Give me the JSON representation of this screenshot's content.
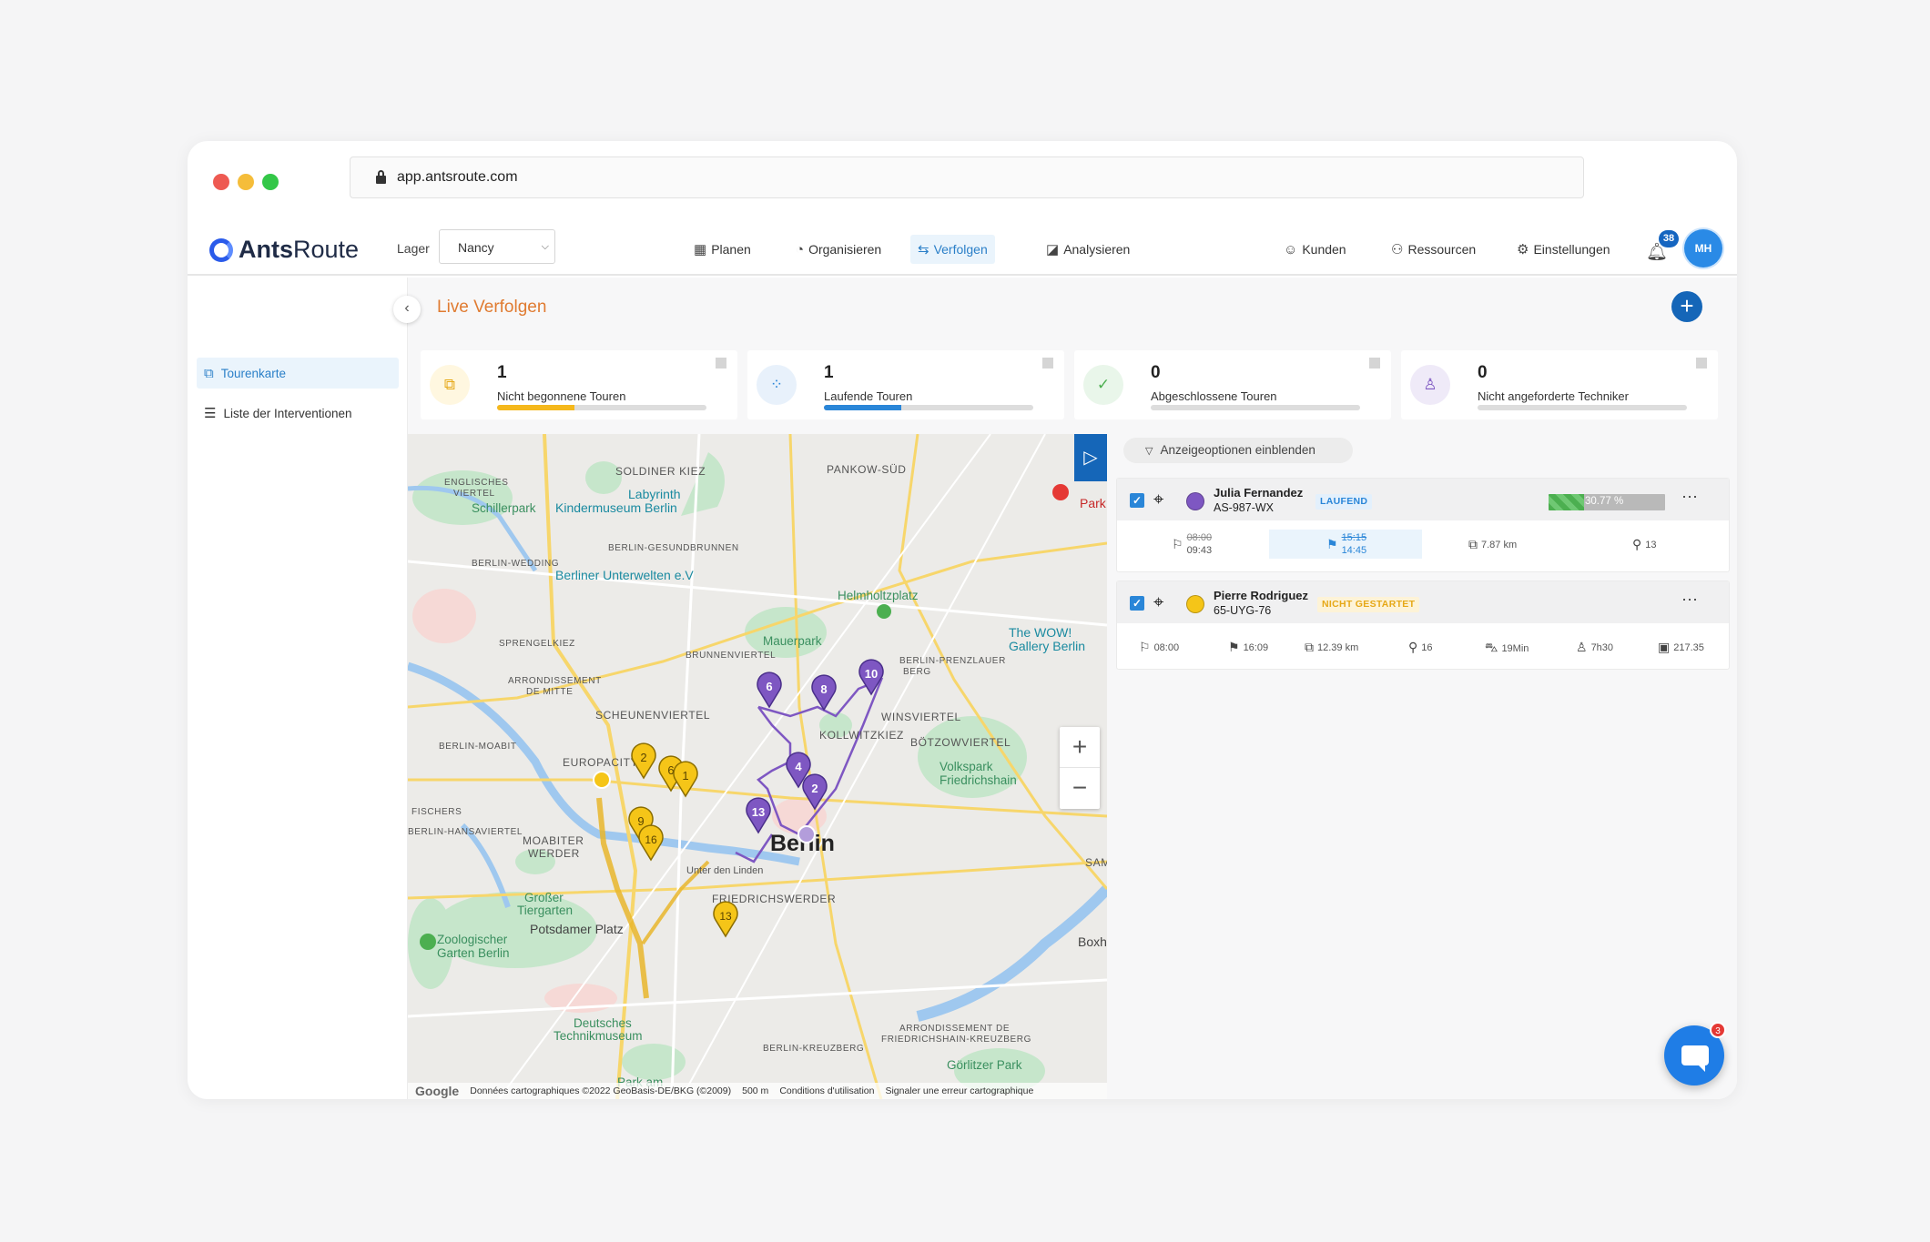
{
  "browser": {
    "url": "app.antsroute.com"
  },
  "app": {
    "logo": {
      "part1": "Ants",
      "part2": "Route"
    },
    "lager": {
      "label": "Lager",
      "value": "Nancy"
    },
    "nav": [
      {
        "label": "Planen",
        "icon": "calendar-icon"
      },
      {
        "label": "Organisieren",
        "icon": "gauge-icon"
      },
      {
        "label": "Verfolgen",
        "icon": "signpost-icon",
        "active": true
      },
      {
        "label": "Analysieren",
        "icon": "chart-icon"
      },
      {
        "label": "Kunden",
        "icon": "customers-icon"
      },
      {
        "label": "Ressourcen",
        "icon": "resources-icon"
      },
      {
        "label": "Einstellungen",
        "icon": "gear-icon"
      }
    ],
    "notifications": {
      "count": "38"
    },
    "user": {
      "initials": "MH"
    }
  },
  "sidebar": {
    "items": [
      {
        "label": "Tourenkarte",
        "icon": "map-icon",
        "active": true
      },
      {
        "label": "Liste der Interventionen",
        "icon": "list-icon"
      }
    ]
  },
  "page": {
    "title": "Live Verfolgen"
  },
  "stats": [
    {
      "value": "1",
      "label": "Nicht begonnene Touren",
      "fill": 0.37,
      "color": "#f5b81c",
      "iconbg": "#fff7e0",
      "iconcolor": "#e6a817"
    },
    {
      "value": "1",
      "label": "Laufende Touren",
      "fill": 0.37,
      "color": "#2a86d8",
      "iconbg": "#e8f1fb",
      "iconcolor": "#2a86d8"
    },
    {
      "value": "0",
      "label": "Abgeschlossene Touren",
      "fill": 0,
      "color": "#4caf50",
      "iconbg": "#e9f6ea",
      "iconcolor": "#4caf50"
    },
    {
      "value": "0",
      "label": "Nicht angeforderte Techniker",
      "fill": 0,
      "color": "#7e57c2",
      "iconbg": "#efeaf8",
      "iconcolor": "#7e57c2"
    }
  ],
  "map": {
    "labels": {
      "soldiner": "SOLDINER KIEZ",
      "pankow": "PANKOW-SÜD",
      "labyrinth": "Labyrinth",
      "kindermuseum": "Kindermuseum Berlin",
      "englisches": "ENGLISCHES",
      "viertel": "VIERTEL",
      "schillerpark": "Schillerpark",
      "gesundbrunnen": "BERLIN-GESUNDBRUNNEN",
      "wedding": "BERLIN-WEDDING",
      "unterwelten": "Berliner Unterwelten e.V",
      "helmholtz": "Helmholtzplatz",
      "mauerpark": "Mauerpark",
      "brunnen": "BRUNNENVIERTEL",
      "sprengel": "SPRENGELKIEZ",
      "wow": "The WOW!",
      "gallery": "Gallery Berlin",
      "prenzlauer": "BERLIN-PRENZLAUER",
      "berg": "BERG",
      "arrondissement": "ARRONDISSEMENT",
      "mitte": "DE MITTE",
      "scheunen": "SCHEUNENVIERTEL",
      "winsviertel": "WINSVIERTEL",
      "kollwitz": "KOLLWITZKIEZ",
      "boetzow": "BÖTZOWVIERTEL",
      "moabit": "BERLIN-MOABIT",
      "europacity": "EUROPACITY",
      "volkspark": "Volkspark",
      "friedrichshain": "Friedrichshain",
      "berlin": "Berlin",
      "fischer": "FISCHERS",
      "hansa": "BERLIN-HANSAVIERTEL",
      "moabiter": "MOABITER",
      "werder": "WERDER",
      "tiergarten1": "Großer",
      "tiergarten2": "Tiergarten",
      "potsdamer": "Potsdamer Platz",
      "zoo1": "Zoologischer",
      "zoo2": "Garten Berlin",
      "friedrichswerder": "FRIEDRICHSWERDER",
      "boxh": "Boxh",
      "technik1": "Deutsches",
      "technik2": "Technikmuseum",
      "kreuzberg": "BERLIN-KREUZBERG",
      "arrondissement2": "ARRONDISSEMENT DE",
      "fkreuzberg": "FRIEDRICHSHAIN-KREUZBERG",
      "goerlitzer": "Görlitzer Park",
      "parkam": "Park am",
      "park": "Park",
      "sam": "SAM",
      "unterlinden": "Unter den Linden"
    },
    "purple_stops": [
      "6",
      "8",
      "10",
      "4",
      "2",
      "13"
    ],
    "yellow_stops": [
      "2",
      "6",
      "1",
      "9",
      "16",
      "13"
    ],
    "zoom_in": "+",
    "zoom_out": "−",
    "footer": {
      "google": "Google",
      "data": "Données cartographiques ©2022 GeoBasis-DE/BKG (©2009)",
      "scale": "500 m",
      "terms": "Conditions d'utilisation",
      "report": "Signaler une erreur cartographique"
    }
  },
  "panel": {
    "filter": "Anzeigeoptionen einblenden",
    "tours": [
      {
        "name": "Julia Fernandez",
        "plate": "AS-987-WX",
        "status": "LAUFEND",
        "color": "#7e57c2",
        "progress": "30.77 %",
        "progress_value": 0.3077,
        "start_planned": "08:00",
        "start_actual": "09:43",
        "end_planned": "15:15",
        "end_actual": "14:45",
        "distance": "7.87 km",
        "stops": "13"
      },
      {
        "name": "Pierre Rodriguez",
        "plate": "65-UYG-76",
        "status": "NICHT GESTARTET",
        "color": "#f5c518",
        "start": "08:00",
        "end": "16:09",
        "distance": "12.39 km",
        "stops": "16",
        "drive": "19Min",
        "work": "7h30",
        "cost": "217.35"
      }
    ]
  },
  "chat": {
    "badge": "3"
  }
}
